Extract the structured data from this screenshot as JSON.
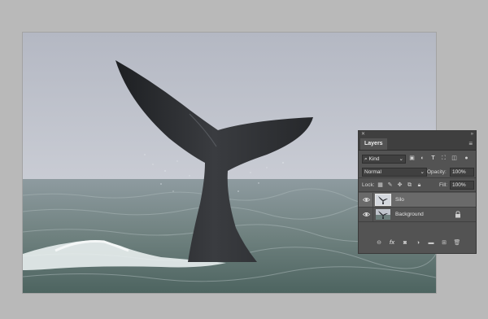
{
  "panel": {
    "tab_label": "Layers",
    "filter_value": "Kind",
    "blend_mode": "Normal",
    "opacity_label": "Opacity:",
    "opacity_value": "100%",
    "lock_label": "Lock:",
    "fill_label": "Fill:",
    "fill_value": "100%",
    "layers": [
      {
        "name": "Silo",
        "visible": true,
        "selected": true
      },
      {
        "name": "Background",
        "visible": true,
        "locked": true
      }
    ],
    "bottom_icons": [
      "link-icon",
      "fx-icon",
      "mask-icon",
      "adjustment-icon",
      "folder-icon",
      "new-layer-icon",
      "trash-icon"
    ]
  },
  "colors": {
    "workspace": "#b9b9b9",
    "panel_bg": "#535353",
    "selected_row": "#6a6a6a"
  }
}
